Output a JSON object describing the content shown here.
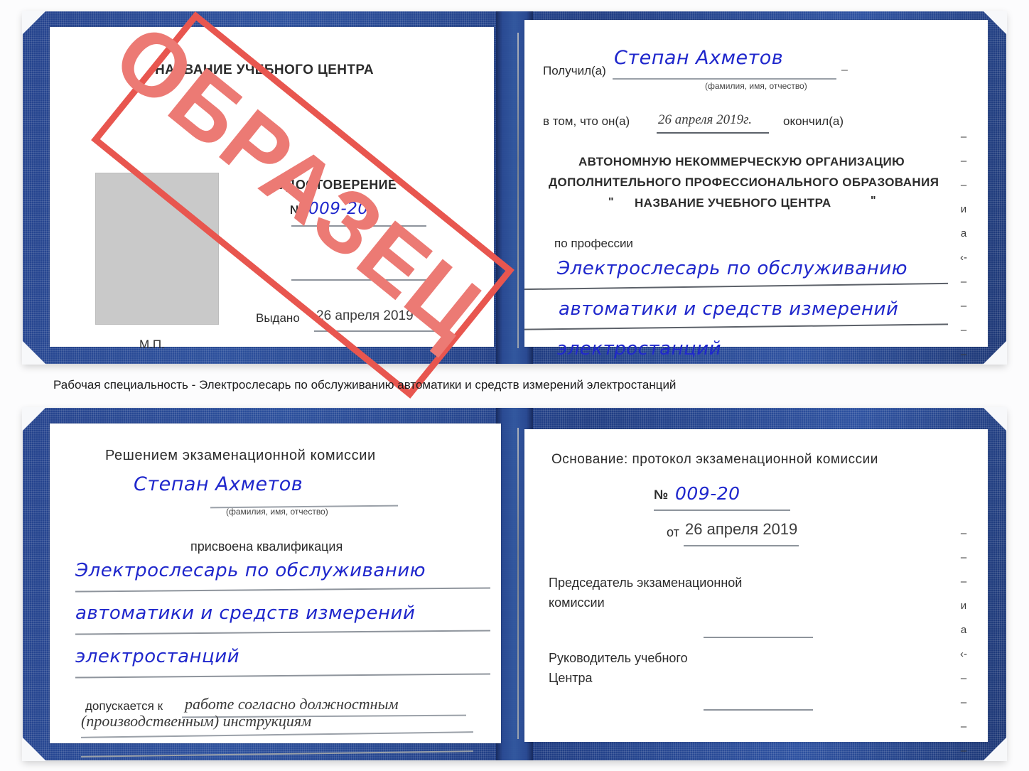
{
  "caption": "Рабочая специальность - Электрослесарь по обслуживанию автоматики и средств измерений электростанций",
  "stamp": {
    "text": "ОБРАЗЕЦ",
    "color": "#e8564f"
  },
  "colors": {
    "cover_blue": "#24428c",
    "handwriting_blue": "#1f27cc",
    "stamp_red": "#e8564f",
    "photo_placeholder": "#c9c9c9",
    "rule_gray": "#8e949c"
  },
  "certificate_front": {
    "left_page": {
      "center_name": "НАЗВАНИЕ УЧЕБНОГО ЦЕНТРА",
      "doc_title": "УДОСТОВЕРЕНИЕ",
      "number_label": "№",
      "number_value": "009-20",
      "issued_label": "Выдано",
      "issued_date": "26 апреля 2019",
      "seal_label": "М.П.",
      "photo_placeholder_label": ""
    },
    "right_page": {
      "received_label": "Получил(а)",
      "received_name": "Степан Ахметов",
      "received_hint": "(фамилия, имя, отчество)",
      "that_he_label": "в том, что он(а)",
      "completion_date": "26 апреля 2019г.",
      "finished_label": "окончил(а)",
      "org_line_1": "АВТОНОМНУЮ НЕКОММЕРЧЕСКУЮ ОРГАНИЗАЦИЮ",
      "org_line_2": "ДОПОЛНИТЕЛЬНОГО ПРОФЕССИОНАЛЬНОГО ОБРАЗОВАНИЯ",
      "org_quote_open": "\"",
      "org_line_3": "НАЗВАНИЕ УЧЕБНОГО ЦЕНТРА",
      "org_quote_close": "\"",
      "profession_label": "по профессии",
      "profession_line_1": "Электрослесарь по обслуживанию",
      "profession_line_2": "автоматики и средств измерений",
      "profession_line_3": "электростанций",
      "margin_marks": [
        "–",
        "–",
        "–",
        "и",
        "а",
        "‹-",
        "–",
        "–",
        "–",
        "–"
      ]
    }
  },
  "certificate_back": {
    "left_page": {
      "heading": "Решением экзаменационной комиссии",
      "name": "Степан Ахметов",
      "name_hint": "(фамилия, имя, отчество)",
      "qualification_label": "присвоена квалификация",
      "qualification_line_1": "Электрослесарь по обслуживанию",
      "qualification_line_2": "автоматики и средств измерений",
      "qualification_line_3": "электростанций",
      "admitted_label": "допускается к",
      "admitted_value_1": "работе согласно должностным",
      "admitted_value_2": "(производственным) инструкциям"
    },
    "right_page": {
      "basis_label": "Основание: протокол экзаменационной комиссии",
      "number_label": "№",
      "number_value": "009-20",
      "date_label": "от",
      "date_value": "26 апреля 2019",
      "chairman_line_1": "Председатель экзаменационной",
      "chairman_line_2": "комиссии",
      "head_line_1": "Руководитель учебного",
      "head_line_2": "Центра",
      "margin_marks": [
        "–",
        "–",
        "–",
        "и",
        "а",
        "‹-",
        "–",
        "–",
        "–",
        "–"
      ]
    }
  }
}
